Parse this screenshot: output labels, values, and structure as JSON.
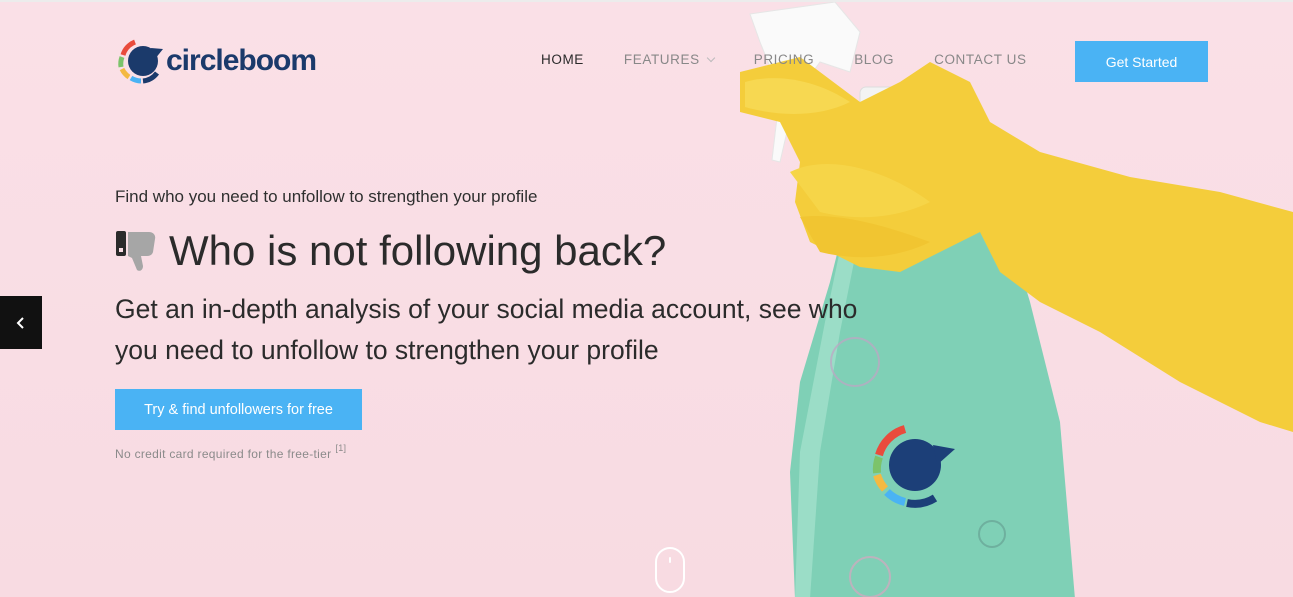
{
  "brand": {
    "name": "circleboom"
  },
  "nav": {
    "items": [
      {
        "label": "HOME",
        "active": true
      },
      {
        "label": "FEATURES",
        "has_dropdown": true
      },
      {
        "label": "PRICING"
      },
      {
        "label": "BLOG"
      },
      {
        "label": "CONTACT US"
      }
    ],
    "cta_label": "Get Started"
  },
  "hero": {
    "tagline": "Find who you need to unfollow to strengthen your profile",
    "headline": "Who is not following back?",
    "subheadline": "Get an in-depth analysis of your social media account, see who you need to unfollow to strengthen your profile",
    "cta_label": "Try & find unfollowers for free",
    "footnote": "No credit card required for the free-tier",
    "footnote_ref": "[1]"
  },
  "icons": {
    "headline_icon": "thumbs-down-icon",
    "prev_icon": "chevron-left-icon",
    "scroll_icon": "mouse-scroll-icon"
  },
  "colors": {
    "accent": "#4ab3f4",
    "brand_navy": "#1b3a6b",
    "background": "#f9dde4"
  }
}
